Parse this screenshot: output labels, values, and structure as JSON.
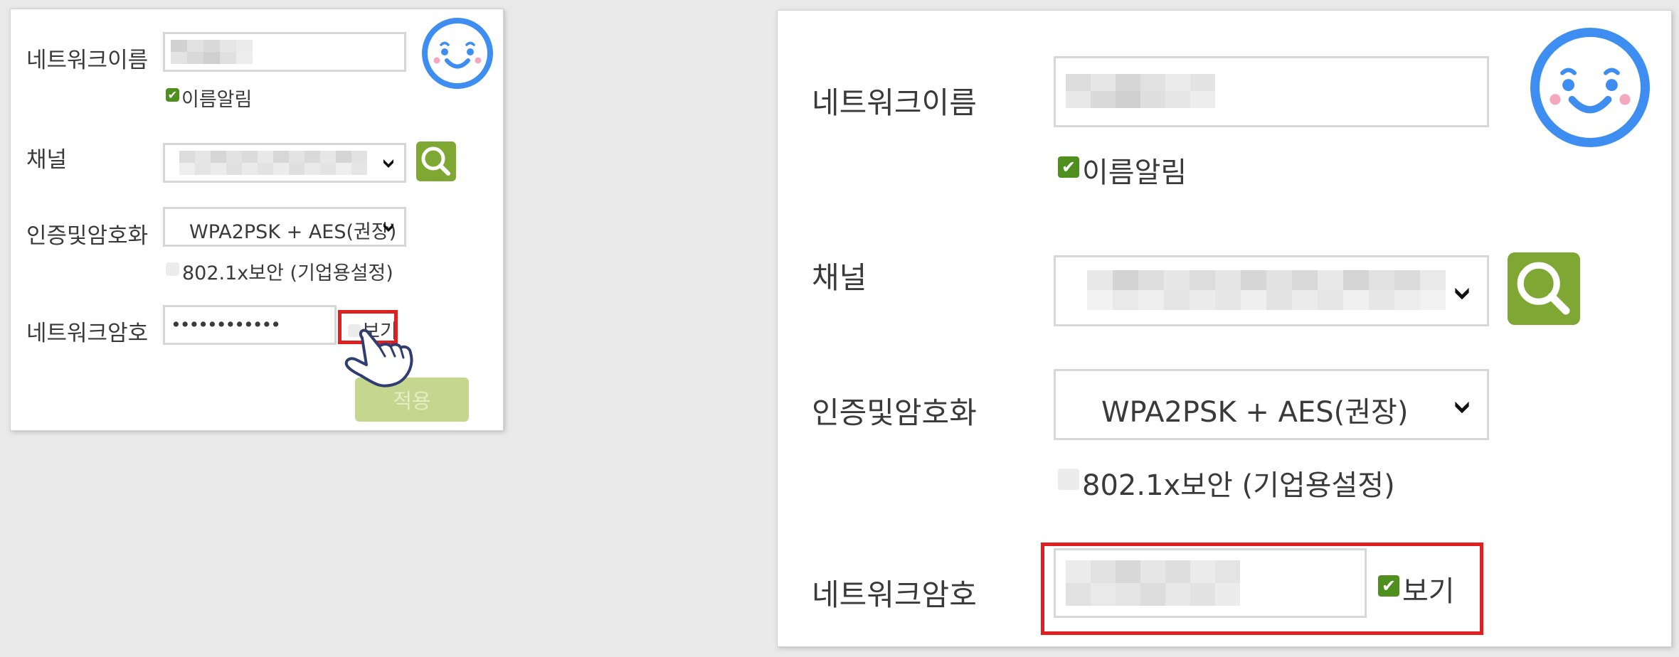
{
  "left": {
    "network_name_label": "네트워크이름",
    "broadcast_name_label": "이름알림",
    "channel_label": "채널",
    "auth_label": "인증및암호화",
    "auth_value": "WPA2PSK + AES(권장)",
    "enterprise_label": "802.1x보안 (기업용설정)",
    "password_label": "네트워크암호",
    "password_value": "••••••••••••",
    "show_label": "보기",
    "apply_label": "적용"
  },
  "right": {
    "network_name_label": "네트워크이름",
    "broadcast_name_label": "이름알림",
    "channel_label": "채널",
    "auth_label": "인증및암호화",
    "auth_value": "WPA2PSK + AES(권장)",
    "enterprise_label": "802.1x보안 (기업용설정)",
    "password_label": "네트워크암호",
    "show_label": "보기"
  },
  "colors": {
    "accent_green": "#7ea833",
    "checkbox_green": "#4f8f1e",
    "highlight_red": "#e02020",
    "smiley_blue": "#3d8ef0"
  },
  "icons": [
    "smiley-icon",
    "search-icon",
    "chevron-down-icon",
    "checkmark-icon",
    "hand-pointer-icon"
  ]
}
